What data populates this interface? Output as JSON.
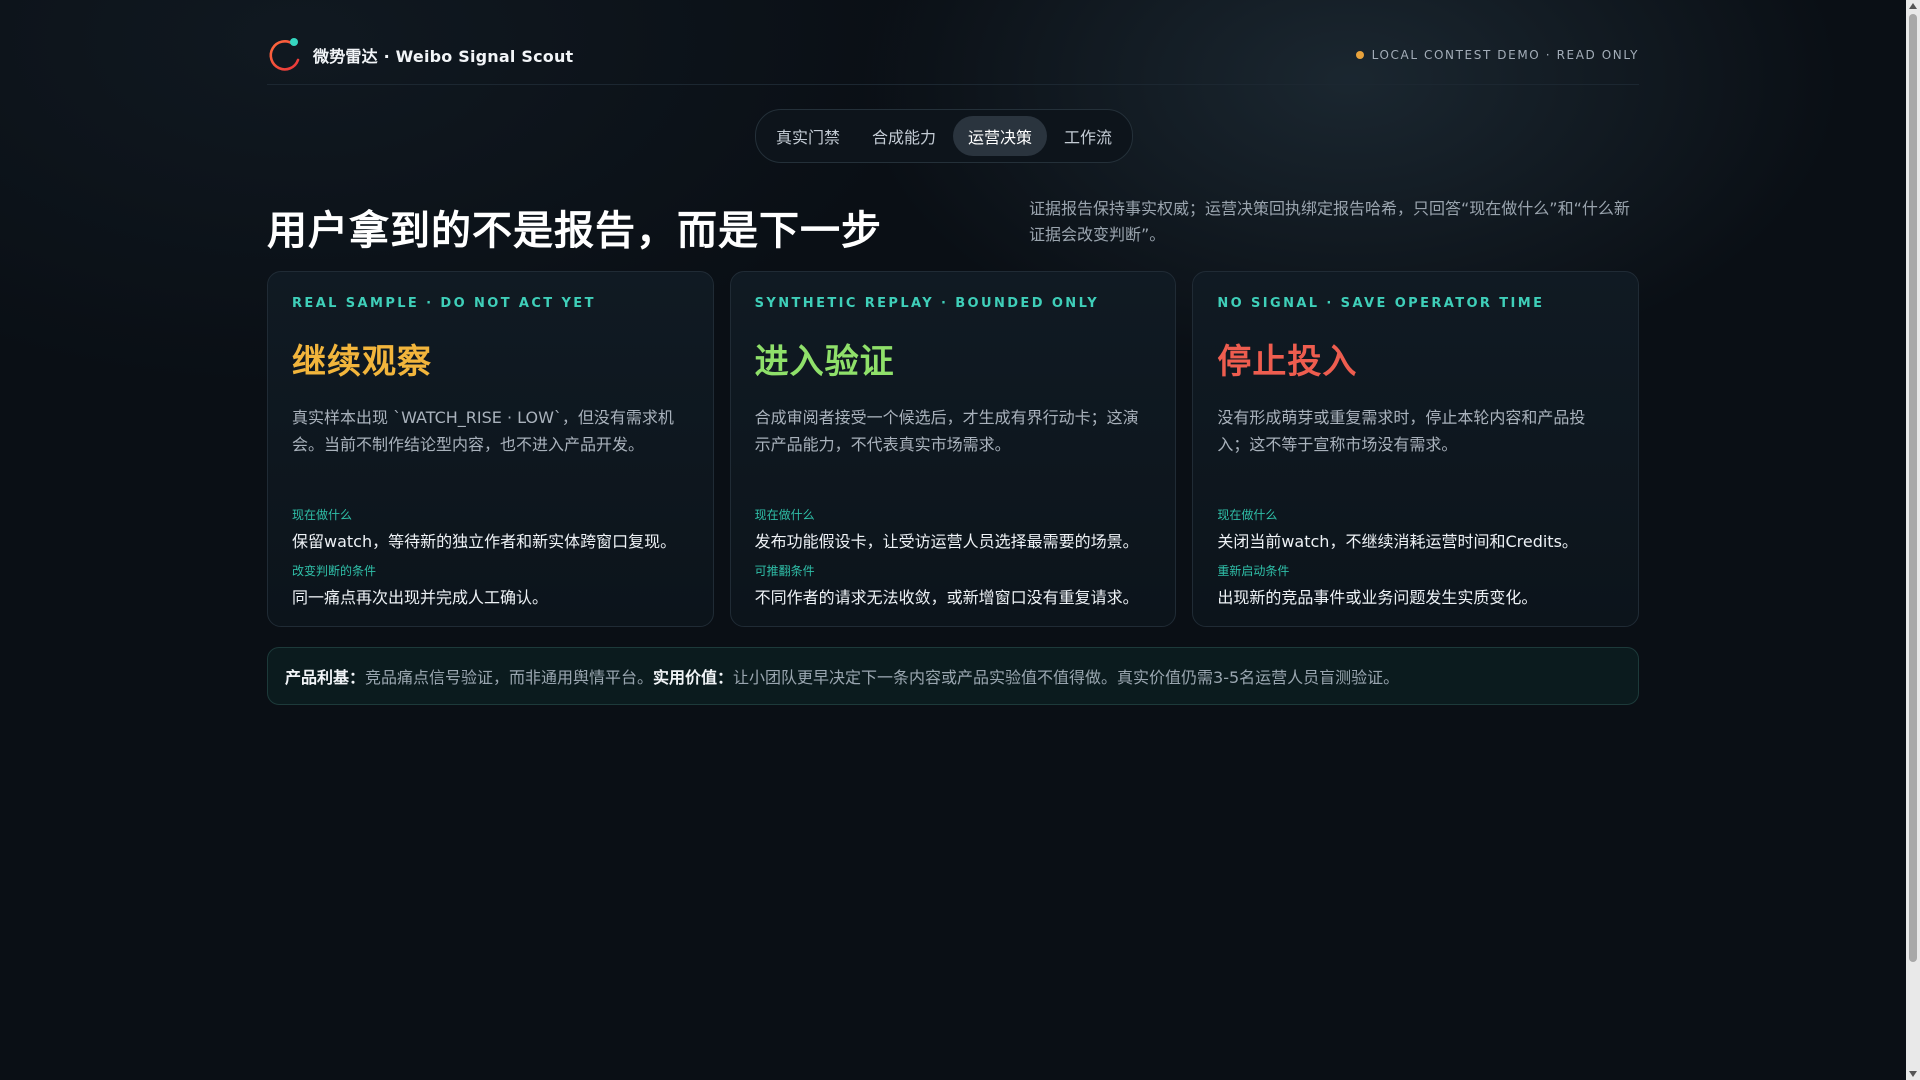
{
  "brand": {
    "name": "微势雷达 · Weibo Signal Scout",
    "logo_icon": "radar-ring-icon"
  },
  "status": {
    "text": "LOCAL CONTEST DEMO · READ ONLY",
    "dot_color": "#e8a23c"
  },
  "tabs": [
    {
      "label": "真实门禁",
      "active": false
    },
    {
      "label": "合成能力",
      "active": false
    },
    {
      "label": "运营决策",
      "active": true
    },
    {
      "label": "工作流",
      "active": false
    }
  ],
  "headline": "用户拿到的不是报告，而是下一步",
  "intro": "证据报告保持事实权威；运营决策回执绑定报告哈希，只回答“现在做什么”和“什么新证据会改变判断”。",
  "cards": [
    {
      "eyebrow": "REAL SAMPLE · DO NOT ACT YET",
      "title": "继续观察",
      "title_color": "#f2b53c",
      "desc": "真实样本出现 `WATCH_RISE · LOW`，但没有需求机会。当前不制作结论型内容，也不进入产品开发。",
      "label1": "现在做什么",
      "value1": "保留watch，等待新的独立作者和新实体跨窗口复现。",
      "label2": "改变判断的条件",
      "value2": "同一痛点再次出现并完成人工确认。"
    },
    {
      "eyebrow": "SYNTHETIC REPLAY · BOUNDED ONLY",
      "title": "进入验证",
      "title_color": "#8fe06a",
      "desc": "合成审阅者接受一个候选后，才生成有界行动卡；这演示产品能力，不代表真实市场需求。",
      "label1": "现在做什么",
      "value1": "发布功能假设卡，让受访运营人员选择最需要的场景。",
      "label2": "可推翻条件",
      "value2": "不同作者的请求无法收敛，或新增窗口没有重复请求。"
    },
    {
      "eyebrow": "NO SIGNAL · SAVE OPERATOR TIME",
      "title": "停止投入",
      "title_color": "#ee5d4f",
      "desc": "没有形成萌芽或重复需求时，停止本轮内容和产品投入；这不等于宣称市场没有需求。",
      "label1": "现在做什么",
      "value1": "关闭当前watch，不继续消耗运营时间和Credits。",
      "label2": "重新启动条件",
      "value2": "出现新的竞品事件或业务问题发生实质变化。"
    }
  ],
  "note": {
    "label1": "产品利基：",
    "text1": "竞品痛点信号验证，而非通用舆情平台。",
    "label2": "实用价值：",
    "text2": "让小团队更早决定下一条内容或产品实验值不值得做。真实价值仍需3-5名运营人员盲测验证。"
  }
}
